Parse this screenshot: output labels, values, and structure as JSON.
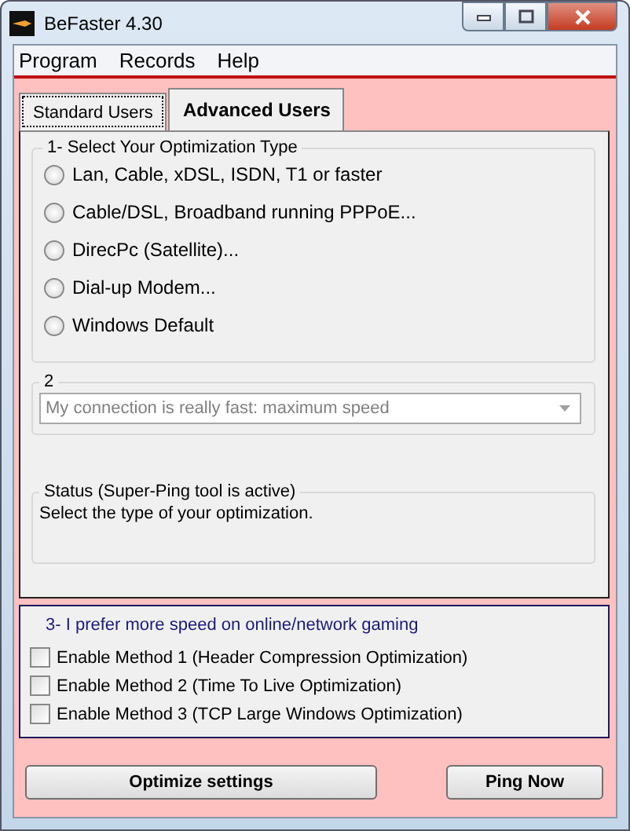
{
  "window": {
    "title": "BeFaster 4.30"
  },
  "menu": [
    "Program",
    "Records",
    "Help"
  ],
  "tabs": [
    {
      "label": "Standard Users",
      "selected": false
    },
    {
      "label": "Advanced Users",
      "selected": true
    }
  ],
  "optimization_type": {
    "title": "1- Select Your Optimization Type",
    "options": [
      {
        "label": "Lan, Cable, xDSL, ISDN, T1 or faster",
        "selected": false
      },
      {
        "label": "Cable/DSL, Broadband running PPPoE...",
        "selected": false
      },
      {
        "label": "DirecPc (Satellite)...",
        "selected": false
      },
      {
        "label": "Dial-up Modem...",
        "selected": false
      },
      {
        "label": "Windows Default",
        "selected": false
      }
    ]
  },
  "speed": {
    "title": "2",
    "value": "My connection is really fast: maximum speed",
    "disabled": true
  },
  "status": {
    "title": "Status   (Super-Ping tool is active)",
    "message": "Select the type of your optimization."
  },
  "gaming": {
    "title": "3- I prefer more speed on online/network gaming",
    "methods": [
      {
        "label": "Enable Method 1 (Header Compression Optimization)",
        "checked": false
      },
      {
        "label": "Enable Method 2 (Time To Live Optimization)",
        "checked": false
      },
      {
        "label": "Enable Method 3 (TCP Large Windows Optimization)",
        "checked": false
      }
    ]
  },
  "buttons": [
    "Optimize settings",
    "Ping Now"
  ]
}
